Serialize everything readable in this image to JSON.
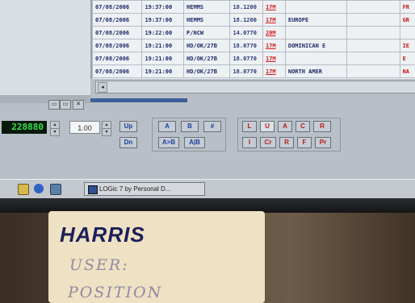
{
  "log_table": {
    "rows": [
      [
        "07/08/2006",
        "19:37:00",
        "HEMMS",
        "18.1200",
        "17M",
        "",
        "",
        "FR"
      ],
      [
        "07/08/2006",
        "19:37:00",
        "HEMMS",
        "18.1200",
        "17M",
        "EUROPE",
        "",
        "GR"
      ],
      [
        "07/08/2006",
        "19:22:00",
        "P/NCW",
        "14.0770",
        "20M",
        "",
        "",
        ""
      ],
      [
        "07/08/2006",
        "19:21:00",
        "HD/OK/27B",
        "18.0770",
        "17M",
        "DOMINICAN E",
        "",
        "IE"
      ],
      [
        "07/08/2006",
        "19:21:00",
        "HD/OK/27B",
        "18.0770",
        "17M",
        "",
        "",
        "E"
      ],
      [
        "07/08/2006",
        "19:21:00",
        "HD/OK/27B",
        "18.0770",
        "17M",
        "NORTH AMER",
        "",
        "NA"
      ]
    ]
  },
  "scrollbar": {
    "left_arrow": "◂"
  },
  "panel_buttons": [
    "▭",
    "▭",
    "✕"
  ],
  "radio": {
    "frequency": "228880",
    "step": "1.00",
    "spin_up": "▴",
    "spin_down": "▾",
    "up_label": "Up",
    "down_label": "Dn",
    "mode_row1": [
      "A",
      "B",
      "#"
    ],
    "mode_row2": [
      "A>B",
      "A|B"
    ],
    "filter_row1": [
      "L",
      "U",
      "A",
      "C",
      "R"
    ],
    "filter_row2": [
      "I",
      "Cr",
      "R",
      "F",
      "Pr"
    ]
  },
  "taskbar": {
    "task_label": "LOGic 7 by Personal D..."
  },
  "sticker": {
    "brand": "HARRIS",
    "line1": "USER:",
    "line2": "POSITION"
  }
}
